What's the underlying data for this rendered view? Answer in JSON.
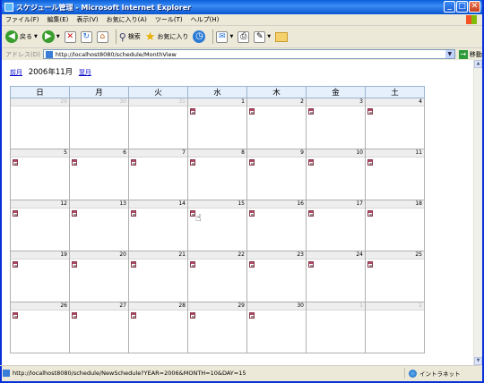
{
  "window": {
    "title": "スケジュール管理 - Microsoft Internet Explorer"
  },
  "menubar": {
    "items": [
      "ファイル(F)",
      "編集(E)",
      "表示(V)",
      "お気に入り(A)",
      "ツール(T)",
      "ヘルプ(H)"
    ]
  },
  "toolbar": {
    "back_label": "戻る",
    "search_label": "検索",
    "favorites_label": "お気に入り"
  },
  "address": {
    "label": "アドレス(D)",
    "url": "http://localhost8080/schedule/MonthView",
    "go_label": "移動"
  },
  "calendar": {
    "prev_link": "前月",
    "current_month": "2006年11月",
    "next_link": "翌月",
    "weekdays": [
      "日",
      "月",
      "火",
      "水",
      "木",
      "金",
      "土"
    ],
    "weeks": [
      [
        {
          "day": "29",
          "other": true
        },
        {
          "day": "30",
          "other": true
        },
        {
          "day": "31",
          "other": true
        },
        {
          "day": "1"
        },
        {
          "day": "2"
        },
        {
          "day": "3"
        },
        {
          "day": "4"
        }
      ],
      [
        {
          "day": "5"
        },
        {
          "day": "6"
        },
        {
          "day": "7"
        },
        {
          "day": "8"
        },
        {
          "day": "9"
        },
        {
          "day": "10"
        },
        {
          "day": "11"
        }
      ],
      [
        {
          "day": "12"
        },
        {
          "day": "13"
        },
        {
          "day": "14"
        },
        {
          "day": "15"
        },
        {
          "day": "16"
        },
        {
          "day": "17"
        },
        {
          "day": "18"
        }
      ],
      [
        {
          "day": "19"
        },
        {
          "day": "20"
        },
        {
          "day": "21"
        },
        {
          "day": "22"
        },
        {
          "day": "23"
        },
        {
          "day": "24"
        },
        {
          "day": "25"
        }
      ],
      [
        {
          "day": "26"
        },
        {
          "day": "27"
        },
        {
          "day": "28"
        },
        {
          "day": "29"
        },
        {
          "day": "30"
        },
        {
          "day": "1",
          "other": true
        },
        {
          "day": "2",
          "other": true
        }
      ]
    ]
  },
  "statusbar": {
    "text": "http://localhost8080/schedule/NewSchedule?YEAR=2006&MONTH=10&DAY=15",
    "zone": "イントラネット"
  }
}
